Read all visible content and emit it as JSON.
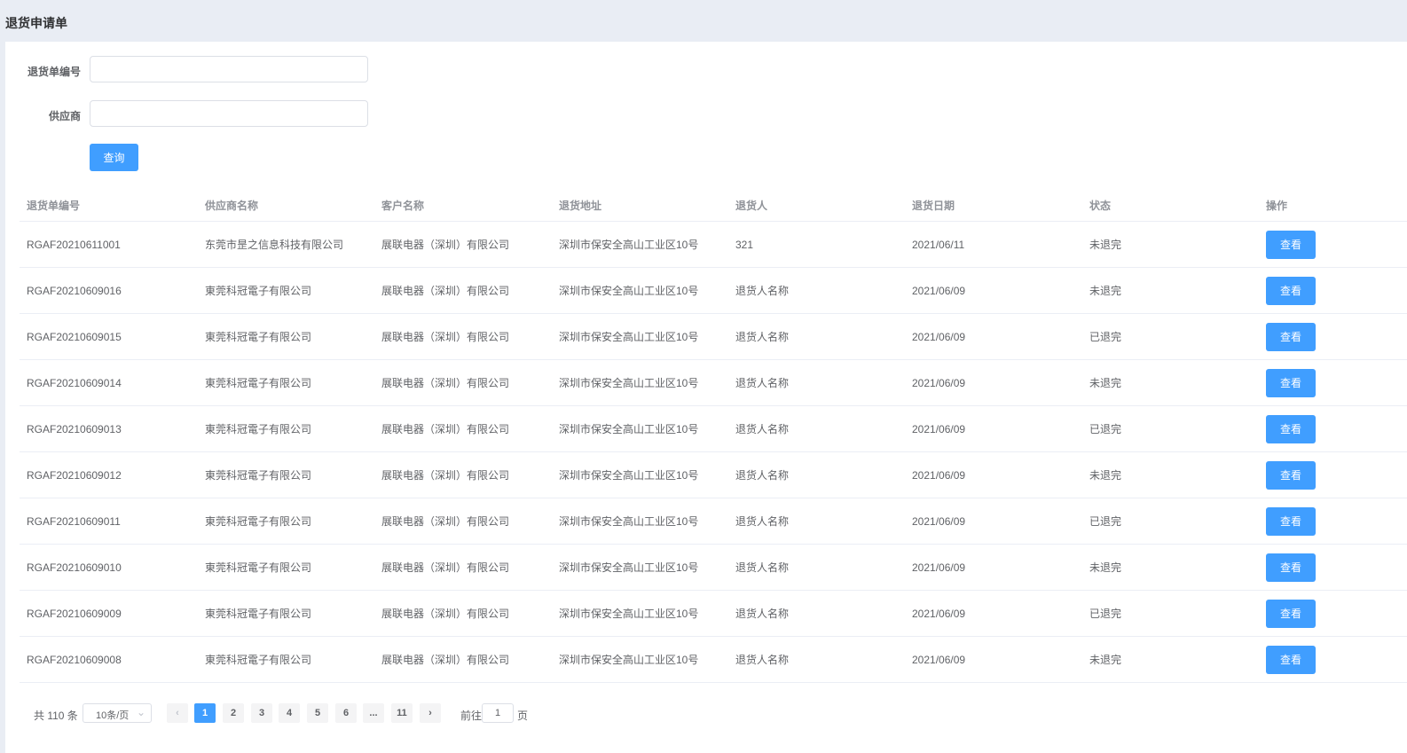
{
  "header": {
    "title": "退货申请单"
  },
  "form": {
    "return_no_label": "退货单编号",
    "return_no_value": "",
    "supplier_label": "供应商",
    "supplier_value": "",
    "query_button": "查询"
  },
  "table": {
    "columns": [
      "退货单编号",
      "供应商名称",
      "客户名称",
      "退货地址",
      "退货人",
      "退货日期",
      "状态",
      "操作"
    ],
    "action_label": "查看",
    "rows": [
      {
        "no": "RGAF20210611001",
        "supplier": "东莞市昰之信息科技有限公司",
        "customer": "展联电器（深圳）有限公司",
        "address": "深圳市保安全高山工业区10号",
        "person": "321",
        "date": "2021/06/11",
        "status": "未退完"
      },
      {
        "no": "RGAF20210609016",
        "supplier": "東莞科冠電子有限公司",
        "customer": "展联电器（深圳）有限公司",
        "address": "深圳市保安全高山工业区10号",
        "person": "退货人名称",
        "date": "2021/06/09",
        "status": "未退完"
      },
      {
        "no": "RGAF20210609015",
        "supplier": "東莞科冠電子有限公司",
        "customer": "展联电器（深圳）有限公司",
        "address": "深圳市保安全高山工业区10号",
        "person": "退货人名称",
        "date": "2021/06/09",
        "status": "已退完"
      },
      {
        "no": "RGAF20210609014",
        "supplier": "東莞科冠電子有限公司",
        "customer": "展联电器（深圳）有限公司",
        "address": "深圳市保安全高山工业区10号",
        "person": "退货人名称",
        "date": "2021/06/09",
        "status": "未退完"
      },
      {
        "no": "RGAF20210609013",
        "supplier": "東莞科冠電子有限公司",
        "customer": "展联电器（深圳）有限公司",
        "address": "深圳市保安全高山工业区10号",
        "person": "退货人名称",
        "date": "2021/06/09",
        "status": "已退完"
      },
      {
        "no": "RGAF20210609012",
        "supplier": "東莞科冠電子有限公司",
        "customer": "展联电器（深圳）有限公司",
        "address": "深圳市保安全高山工业区10号",
        "person": "退货人名称",
        "date": "2021/06/09",
        "status": "未退完"
      },
      {
        "no": "RGAF20210609011",
        "supplier": "東莞科冠電子有限公司",
        "customer": "展联电器（深圳）有限公司",
        "address": "深圳市保安全高山工业区10号",
        "person": "退货人名称",
        "date": "2021/06/09",
        "status": "已退完"
      },
      {
        "no": "RGAF20210609010",
        "supplier": "東莞科冠電子有限公司",
        "customer": "展联电器（深圳）有限公司",
        "address": "深圳市保安全高山工业区10号",
        "person": "退货人名称",
        "date": "2021/06/09",
        "status": "未退完"
      },
      {
        "no": "RGAF20210609009",
        "supplier": "東莞科冠電子有限公司",
        "customer": "展联电器（深圳）有限公司",
        "address": "深圳市保安全高山工业区10号",
        "person": "退货人名称",
        "date": "2021/06/09",
        "status": "已退完"
      },
      {
        "no": "RGAF20210609008",
        "supplier": "東莞科冠電子有限公司",
        "customer": "展联电器（深圳）有限公司",
        "address": "深圳市保安全高山工业区10号",
        "person": "退货人名称",
        "date": "2021/06/09",
        "status": "未退完"
      }
    ]
  },
  "pagination": {
    "total_text": "共 110 条",
    "page_size": "10条/页",
    "pages": [
      "1",
      "2",
      "3",
      "4",
      "5",
      "6",
      "...",
      "11"
    ],
    "current": "1",
    "jump_prefix": "前往",
    "jump_value": "1",
    "jump_suffix": "页",
    "prev_icon": "chevron-left-icon",
    "next_icon": "chevron-right-icon"
  },
  "colors": {
    "primary": "#409eff",
    "header_bg": "#e9edf4"
  }
}
